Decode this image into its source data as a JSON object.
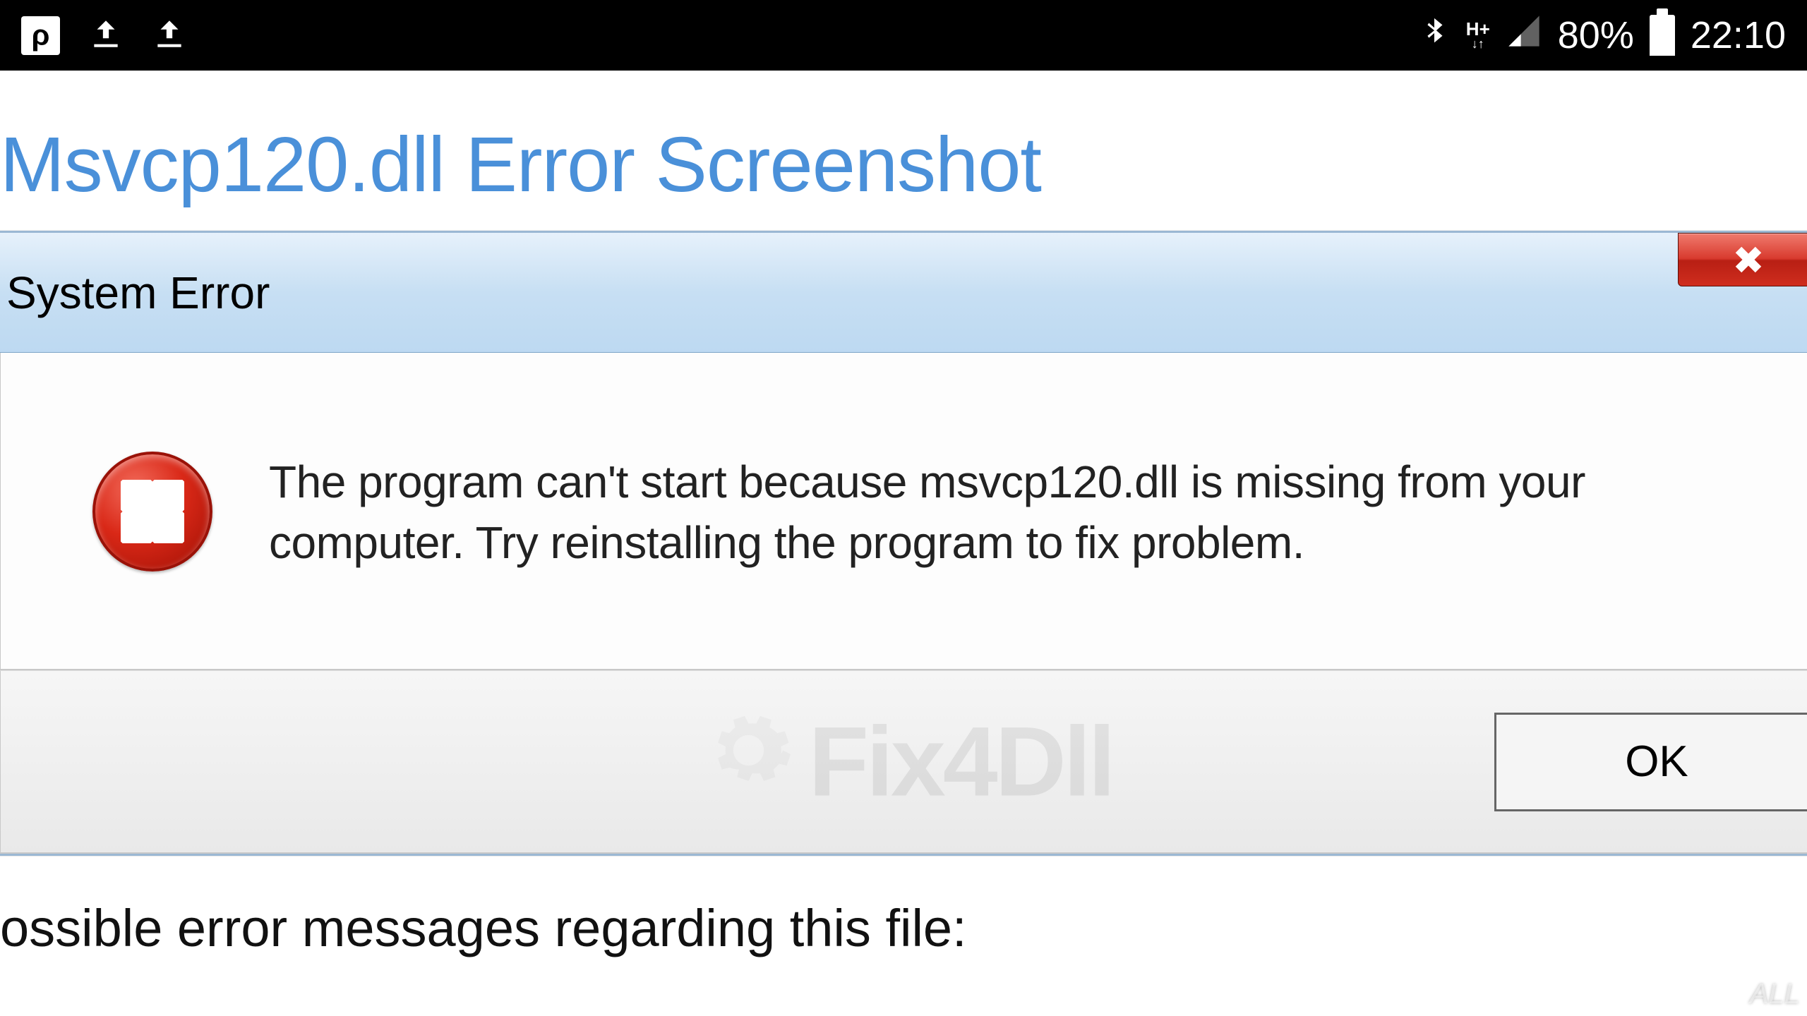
{
  "statusbar": {
    "battery_pct": "80%",
    "time": "22:10",
    "net_label_top": "H+",
    "net_label_bottom": "↓↑"
  },
  "page": {
    "heading": "Msvcp120.dll Error Screenshot",
    "below_fragment": "ossible error messages regarding this file:"
  },
  "dialog": {
    "title": "System Error",
    "message": "The program can't start because msvcp120.dll is missing from your computer. Try reinstalling the program to fix problem.",
    "ok_label": "OK",
    "watermark": "Fix4Dll"
  },
  "corner_watermark": "ALL"
}
